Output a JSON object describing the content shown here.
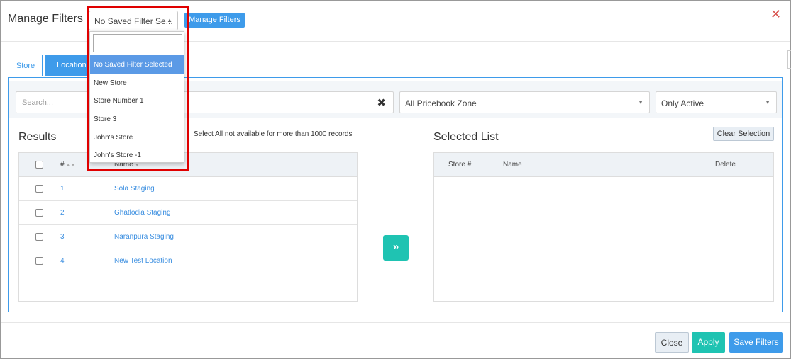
{
  "header": {
    "title": "Manage Filters",
    "saved_filter_value": "No Saved Filter Se...",
    "manage_filters_label": "Manage Filters",
    "close_glyph": "✕"
  },
  "saved_filter_dropdown": {
    "search_value": "",
    "options": [
      "No Saved Filter Selected",
      "New Store",
      "Store Number 1",
      "Store 3",
      "John's Store",
      "John's Store -1"
    ]
  },
  "tabs": [
    {
      "label": "Store"
    },
    {
      "label": "Location S"
    }
  ],
  "filters": {
    "search_placeholder": "Search...",
    "clear_glyph": "✖",
    "zone_value": "All Pricebook Zone",
    "status_value": "Only Active"
  },
  "results": {
    "heading": "Results",
    "note": "Select All not available for more than 1000 records",
    "columns": [
      "#",
      "Name"
    ],
    "rows": [
      {
        "num": "1",
        "name": "Sola Staging"
      },
      {
        "num": "2",
        "name": "Ghatlodia Staging"
      },
      {
        "num": "3",
        "name": "Naranpura Staging"
      },
      {
        "num": "4",
        "name": "New Test Location"
      }
    ]
  },
  "selected": {
    "heading": "Selected List",
    "clear_label": "Clear Selection",
    "columns": [
      "Store #",
      "Name",
      "Delete"
    ]
  },
  "move_glyph": "»",
  "footer": {
    "close_label": "Close",
    "apply_label": "Apply",
    "save_label": "Save Filters"
  },
  "colors": {
    "primary": "#3e9bea",
    "teal": "#1fc3b2",
    "highlight": "#e00000",
    "close_red": "#d9534f",
    "link": "#3a8ee0"
  }
}
